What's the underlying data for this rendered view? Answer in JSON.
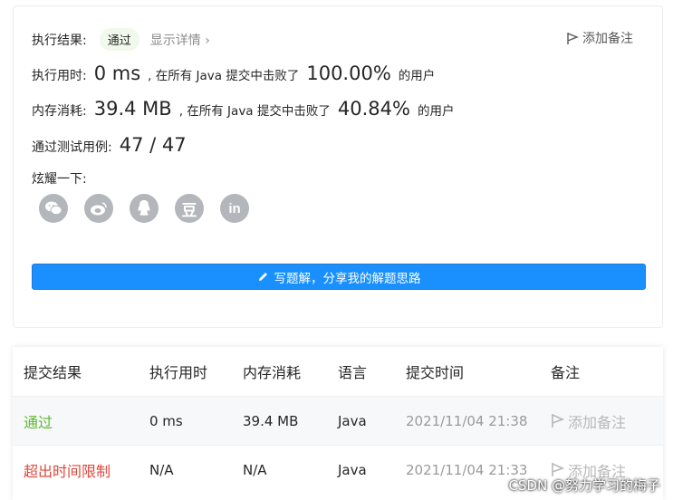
{
  "summary": {
    "result_label": "执行结果:",
    "result_value": "通过",
    "detail_link": "显示详情",
    "add_note": "添加备注",
    "runtime_label": "执行用时:",
    "runtime_value": "0 ms",
    "beat_prefix": ", 在所有 Java 提交中击败了",
    "runtime_percent": "100.00%",
    "beat_suffix": "的用户",
    "memory_label": "内存消耗:",
    "memory_value": "39.4 MB",
    "memory_percent": "40.84%",
    "tests_label": "通过测试用例:",
    "tests_value": "47 / 47",
    "share_label": "炫耀一下:",
    "share_icons": [
      "wechat-icon",
      "weibo-icon",
      "qq-icon",
      "douban-icon",
      "linkedin-icon"
    ],
    "douban_glyph": "豆",
    "linkedin_glyph": "in",
    "write_button": "写题解，分享我的解题思路"
  },
  "table": {
    "headers": [
      "提交结果",
      "执行用时",
      "内存消耗",
      "语言",
      "提交时间",
      "备注"
    ],
    "rows": [
      {
        "result": "通过",
        "time": "0 ms",
        "memory": "39.4 MB",
        "lang": "Java",
        "submitted": "2021/11/04 21:38",
        "note": "添加备注"
      },
      {
        "result": "超出时间限制",
        "time": "N/A",
        "memory": "N/A",
        "lang": "Java",
        "submitted": "2021/11/04 21:33",
        "note": "添加备注"
      }
    ]
  },
  "watermark": "CSDN @努力学习的梅子",
  "colors": {
    "accent": "#1a90ff",
    "pass": "#5cb82f",
    "fail": "#e0473b"
  }
}
